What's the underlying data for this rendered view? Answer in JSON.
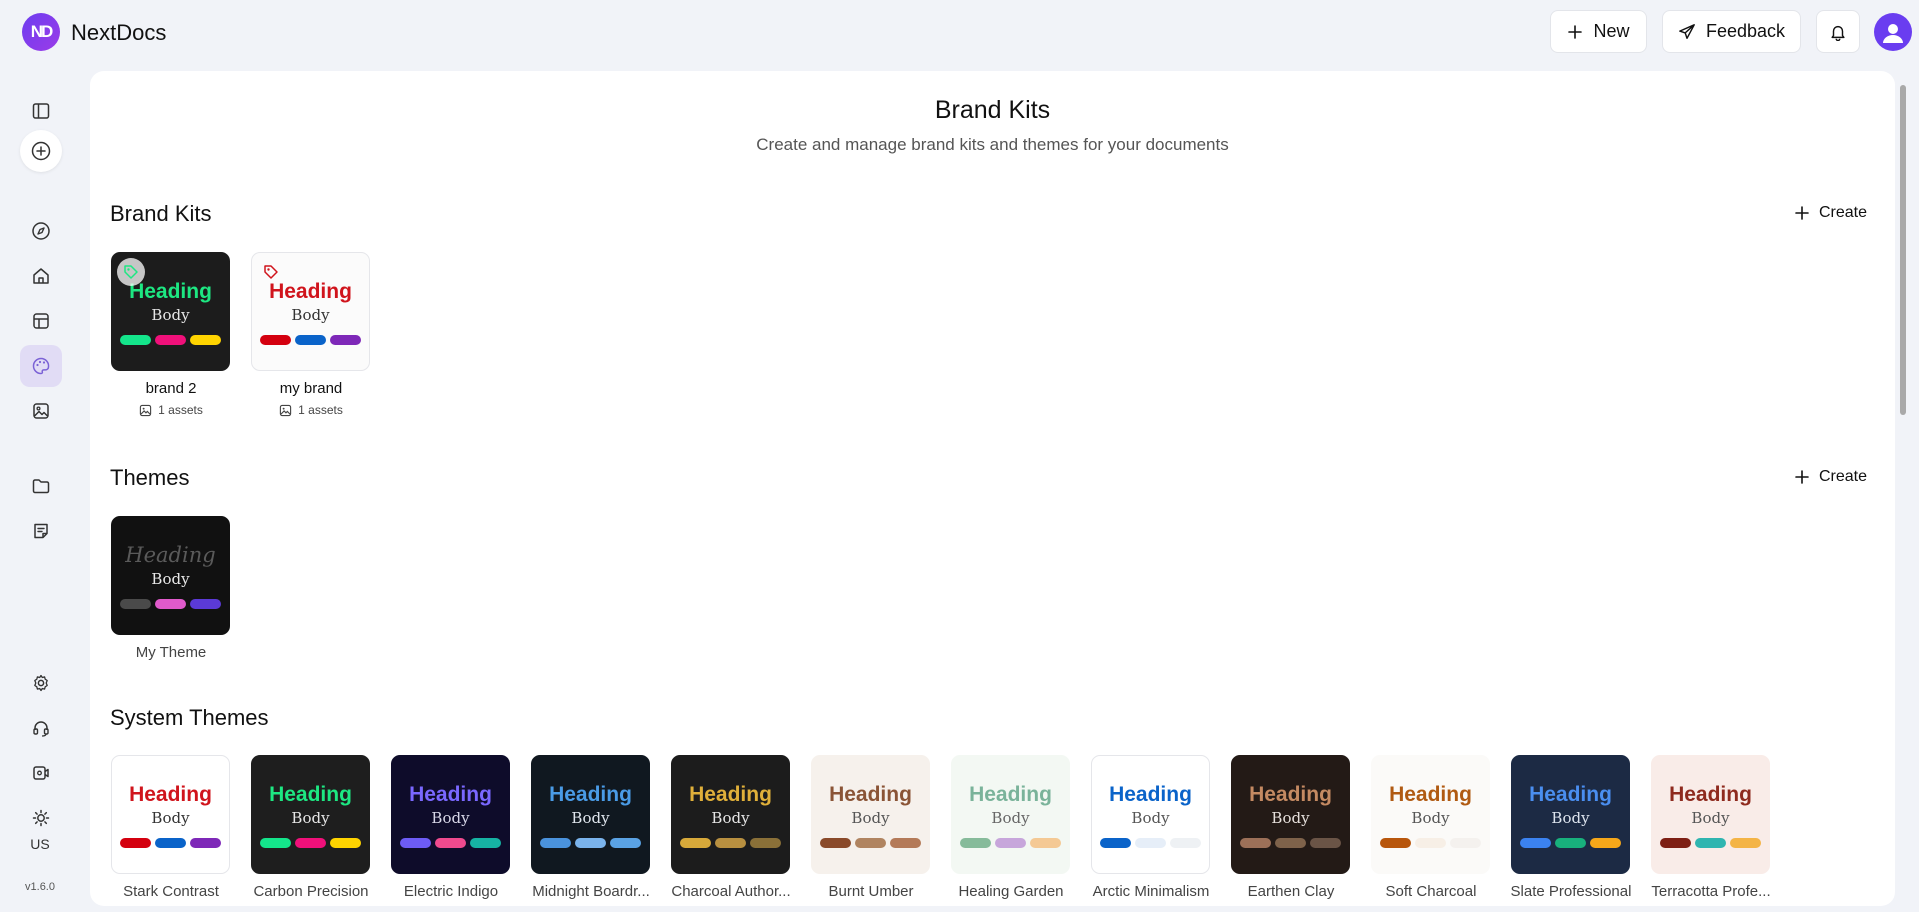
{
  "app": {
    "logo_text": "ND",
    "name": "NextDocs",
    "version": "v1.6.0",
    "locale": "US"
  },
  "topbar": {
    "new_label": "New",
    "feedback_label": "Feedback"
  },
  "sidebar": {
    "icons": [
      "sidebar-toggle-icon",
      "plus-circle-icon",
      "compass-icon",
      "home-icon",
      "layout-icon",
      "palette-icon",
      "image-icon",
      "folder-icon",
      "notes-icon",
      "gear-icon",
      "headset-icon",
      "video-icon",
      "sun-icon"
    ]
  },
  "page": {
    "title": "Brand Kits",
    "subtitle": "Create and manage brand kits and themes for your documents"
  },
  "brand_kits": {
    "title": "Brand Kits",
    "create_label": "Create",
    "items": [
      {
        "name": "brand 2",
        "assets": "1 assets",
        "heading": "Heading",
        "body": "Body",
        "bg": "#1c1c1c",
        "heading_color": "#1de782",
        "body_color": "#e6e6e6",
        "pills": [
          "#14e58b",
          "#f0107a",
          "#ffd400"
        ],
        "tag_color": "#1de782"
      },
      {
        "name": "my brand",
        "assets": "1 assets",
        "heading": "Heading",
        "body": "Body",
        "bg": "#fbfbfb",
        "heading_color": "#d0141c",
        "body_color": "#333333",
        "pills": [
          "#d4000f",
          "#0a63c9",
          "#7e28b8"
        ],
        "tag_color": "#d0141c"
      }
    ]
  },
  "themes": {
    "title": "Themes",
    "create_label": "Create",
    "items": [
      {
        "name": "My Theme",
        "heading": "Heading",
        "body": "Body",
        "bg": "#111111",
        "heading_color": "#5a5a5a",
        "body_color": "#e8e8e8",
        "pills": [
          "#4a4a4a",
          "#e05acb",
          "#5b3ad6"
        ]
      }
    ]
  },
  "system_themes": {
    "title": "System Themes",
    "items": [
      {
        "name": "Stark Contrast",
        "heading": "Heading",
        "body": "Body",
        "bg": "#ffffff",
        "heading_color": "#d0141c",
        "body_color": "#333333",
        "pills": [
          "#d4000f",
          "#0a63c9",
          "#7e28b8"
        ]
      },
      {
        "name": "Carbon Precision",
        "heading": "Heading",
        "body": "Body",
        "bg": "#1e1e1e",
        "heading_color": "#1de782",
        "body_color": "#e6e6e6",
        "pills": [
          "#14e58b",
          "#f0107a",
          "#ffd400"
        ]
      },
      {
        "name": "Electric Indigo",
        "heading": "Heading",
        "body": "Body",
        "bg": "#0e0c2a",
        "heading_color": "#7a68ff",
        "body_color": "#d8d8e8",
        "pills": [
          "#6d5cf5",
          "#ef4a8e",
          "#16b3a3"
        ]
      },
      {
        "name": "Midnight Boardr...",
        "heading": "Heading",
        "body": "Body",
        "bg": "#101820",
        "heading_color": "#4a9be6",
        "body_color": "#e0e6ee",
        "pills": [
          "#4a92dc",
          "#7ab3ec",
          "#5aa2e4"
        ]
      },
      {
        "name": "Charcoal Author...",
        "heading": "Heading",
        "body": "Body",
        "bg": "#1c1c1c",
        "heading_color": "#e0b03a",
        "body_color": "#e6e6e6",
        "pills": [
          "#d7a93a",
          "#b89040",
          "#8a7038"
        ]
      },
      {
        "name": "Burnt Umber",
        "heading": "Heading",
        "body": "Body",
        "bg": "#f6f1ec",
        "heading_color": "#8a5436",
        "body_color": "#555555",
        "pills": [
          "#8a4a2a",
          "#b08460",
          "#b47a58"
        ]
      },
      {
        "name": "Healing Garden",
        "heading": "Heading",
        "body": "Body",
        "bg": "#f3f8f3",
        "heading_color": "#7ab39a",
        "body_color": "#666666",
        "pills": [
          "#86bb9a",
          "#c7a6db",
          "#f4c994"
        ]
      },
      {
        "name": "Arctic Minimalism",
        "heading": "Heading",
        "body": "Body",
        "bg": "#ffffff",
        "heading_color": "#0a63c9",
        "body_color": "#555555",
        "pills": [
          "#0a63c9",
          "#e6eef8",
          "#eef1f4"
        ]
      },
      {
        "name": "Earthen Clay",
        "heading": "Heading",
        "body": "Body",
        "bg": "#231a16",
        "heading_color": "#c48a62",
        "body_color": "#e6e0dc",
        "pills": [
          "#9c7058",
          "#7e624a",
          "#6a5446"
        ]
      },
      {
        "name": "Soft Charcoal",
        "heading": "Heading",
        "body": "Body",
        "bg": "#fbfaf8",
        "heading_color": "#b05a12",
        "body_color": "#555555",
        "pills": [
          "#b8560c",
          "#f7efe6",
          "#f4f1ee"
        ]
      },
      {
        "name": "Slate Professional",
        "heading": "Heading",
        "body": "Body",
        "bg": "#1c2a44",
        "heading_color": "#4a8ef0",
        "body_color": "#dde4ee",
        "pills": [
          "#3b82f0",
          "#18b07c",
          "#f5a71a"
        ]
      },
      {
        "name": "Terracotta Profe...",
        "heading": "Heading",
        "body": "Body",
        "bg": "#f9ece8",
        "heading_color": "#8e2a1e",
        "body_color": "#555555",
        "pills": [
          "#7e1f14",
          "#2fb5b0",
          "#f4b446"
        ]
      }
    ]
  }
}
